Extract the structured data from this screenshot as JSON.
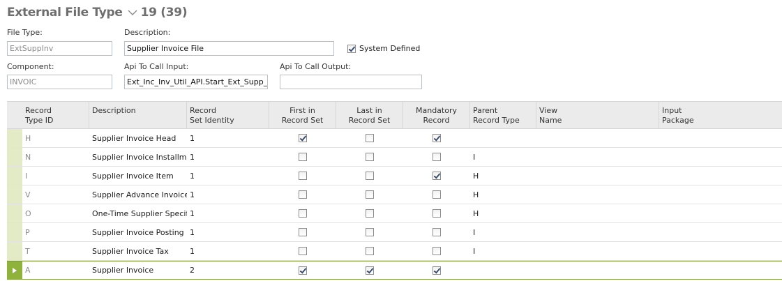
{
  "header": {
    "title": "External File Type",
    "count": "19 (39)"
  },
  "form": {
    "file_type_label": "File Type:",
    "file_type_value": "ExtSuppInv",
    "description_label": "Description:",
    "description_value": "Supplier Invoice File",
    "system_defined_label": "System Defined",
    "system_defined_checked": true,
    "component_label": "Component:",
    "component_value": "INVOIC",
    "api_input_label": "Api To Call Input:",
    "api_input_value": "Ext_Inc_Inv_Util_API.Start_Ext_Supp_In",
    "api_output_label": "Api To Call Output:",
    "api_output_value": ""
  },
  "grid": {
    "columns": {
      "record_type_id": [
        "Record",
        "Type ID"
      ],
      "description": [
        "Description"
      ],
      "record_set_identity": [
        "Record",
        "Set Identity"
      ],
      "first_in_record_set": [
        "First in",
        "Record Set"
      ],
      "last_in_record_set": [
        "Last in",
        "Record Set"
      ],
      "mandatory_record": [
        "Mandatory",
        "Record"
      ],
      "parent_record_type": [
        "Parent",
        "Record Type"
      ],
      "view_name": [
        "View",
        "Name"
      ],
      "input_package": [
        "Input",
        "Package"
      ]
    },
    "rows": [
      {
        "id": "H",
        "description": "Supplier Invoice Head",
        "set_identity": "1",
        "first": true,
        "last": false,
        "mandatory": true,
        "parent": "",
        "selected": false
      },
      {
        "id": "N",
        "description": "Supplier Invoice Installment",
        "set_identity": "1",
        "first": false,
        "last": false,
        "mandatory": false,
        "parent": "I",
        "selected": false
      },
      {
        "id": "I",
        "description": "Supplier Invoice Item",
        "set_identity": "1",
        "first": false,
        "last": false,
        "mandatory": true,
        "parent": "H",
        "selected": false
      },
      {
        "id": "V",
        "description": "Supplier Advance Invoice",
        "set_identity": "1",
        "first": false,
        "last": false,
        "mandatory": false,
        "parent": "H",
        "selected": false
      },
      {
        "id": "O",
        "description": "One-Time Supplier Specifi...",
        "set_identity": "1",
        "first": false,
        "last": false,
        "mandatory": false,
        "parent": "H",
        "selected": false
      },
      {
        "id": "P",
        "description": "Supplier Invoice Posting",
        "set_identity": "1",
        "first": false,
        "last": false,
        "mandatory": false,
        "parent": "I",
        "selected": false
      },
      {
        "id": "T",
        "description": "Supplier Invoice Tax",
        "set_identity": "1",
        "first": false,
        "last": false,
        "mandatory": false,
        "parent": "I",
        "selected": false
      },
      {
        "id": "A",
        "description": "Supplier Invoice",
        "set_identity": "2",
        "first": true,
        "last": true,
        "mandatory": true,
        "parent": "",
        "selected": true
      }
    ]
  }
}
